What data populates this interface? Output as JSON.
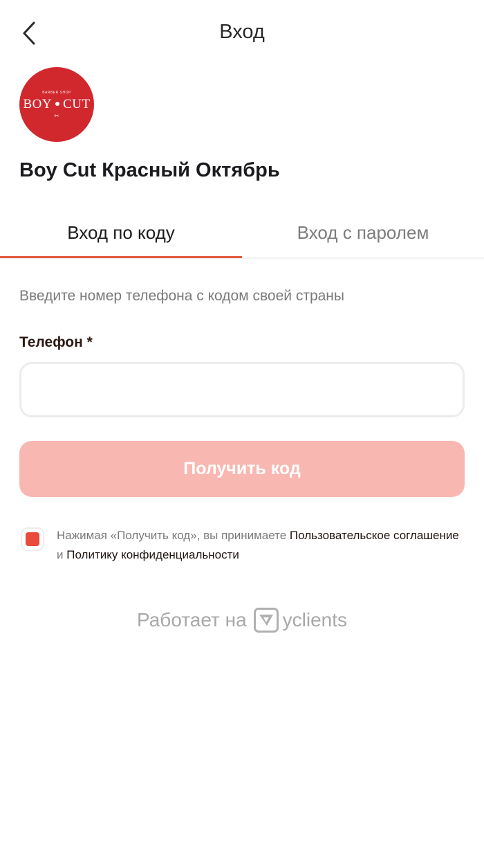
{
  "header": {
    "title": "Вход",
    "back_icon": "chevron-left-icon"
  },
  "company": {
    "logo_top_text": "BARBER SHOP",
    "logo_left": "BOY",
    "logo_right": "CUT",
    "logo_color": "#d1282e",
    "name": "Boy Cut Красный Октябрь"
  },
  "tabs": [
    {
      "label": "Вход по коду",
      "active": true
    },
    {
      "label": "Вход с паролем",
      "active": false
    }
  ],
  "accent_color": "#e25b3d",
  "form": {
    "hint": "Введите номер телефона с кодом своей страны",
    "phone_label": "Телефон *",
    "phone_value": "",
    "submit_label": "Получить код",
    "submit_color": "#f9b7b1"
  },
  "consent": {
    "checked": true,
    "text_prefix": "Нажимая «Получить код», вы принимаете ",
    "agreement_link": "Пользовательское соглашение",
    "conjunction": " и ",
    "privacy_link": "Политику конфиденциальности"
  },
  "footer": {
    "powered_by": "Работает на",
    "brand": "yclients",
    "brand_icon": "yclients-logo-icon"
  }
}
